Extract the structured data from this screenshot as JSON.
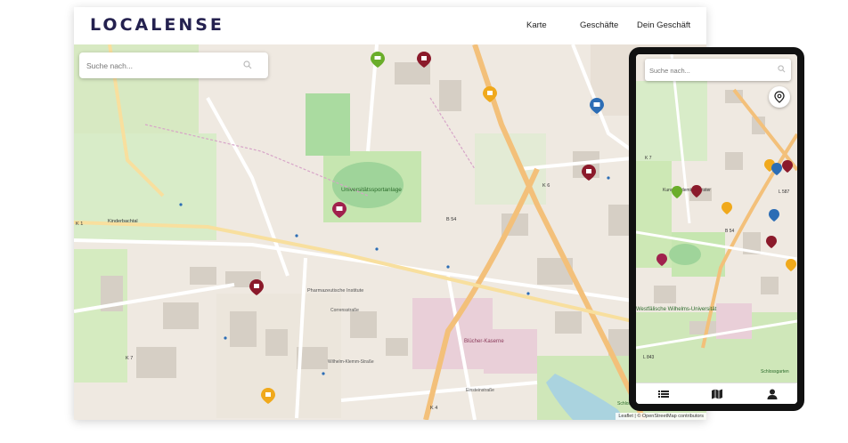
{
  "app": {
    "logo_text": "LOCALENSE",
    "brand_color": "#24214f"
  },
  "nav": {
    "items": [
      {
        "label": "Karte"
      },
      {
        "label": "Geschäfte"
      },
      {
        "label": "Dein Geschäft"
      }
    ]
  },
  "search": {
    "placeholder": "Suche nach...",
    "icon": "search-icon"
  },
  "map": {
    "attribution": "Leaflet | © OpenStreetMap contributors",
    "labels": {
      "stadium": "Universitätssportanlage",
      "barracks": "Blücher-Kaserne",
      "pharma": "Pharmazeutische Institute",
      "kinderbach": "Kinderbachtal",
      "k1": "K 1",
      "k7": "K 7",
      "k4": "K 4",
      "b54": "B 54",
      "k6": "K 6",
      "corrensstrasse": "Corrensstraße",
      "wilhelm": "Wilhelm-Klemm-Straße",
      "einsteinstrasse": "Einsteinstraße",
      "schlossgarten": "Schlossgarten"
    }
  },
  "mobile": {
    "search_placeholder": "Suche nach...",
    "map_labels": {
      "university": "Westfälische Wilhelms-Universität",
      "k7": "K 7",
      "b54": "B 54",
      "l843": "L 843",
      "l587": "L 587",
      "muenster": "Kunstakademie Münster",
      "schlossgarten": "Schlossgarten"
    },
    "bottom_nav": [
      {
        "icon": "list-icon"
      },
      {
        "icon": "map-icon"
      },
      {
        "icon": "user-icon"
      }
    ]
  },
  "colors": {
    "marker_darkred": "#8b1a2b",
    "marker_green": "#6aad2a",
    "marker_orange": "#f0a91c",
    "marker_blue": "#2c6db5",
    "marker_magenta": "#a0224d",
    "road_orange": "#f3c07a",
    "park_green": "#cde8b5"
  }
}
